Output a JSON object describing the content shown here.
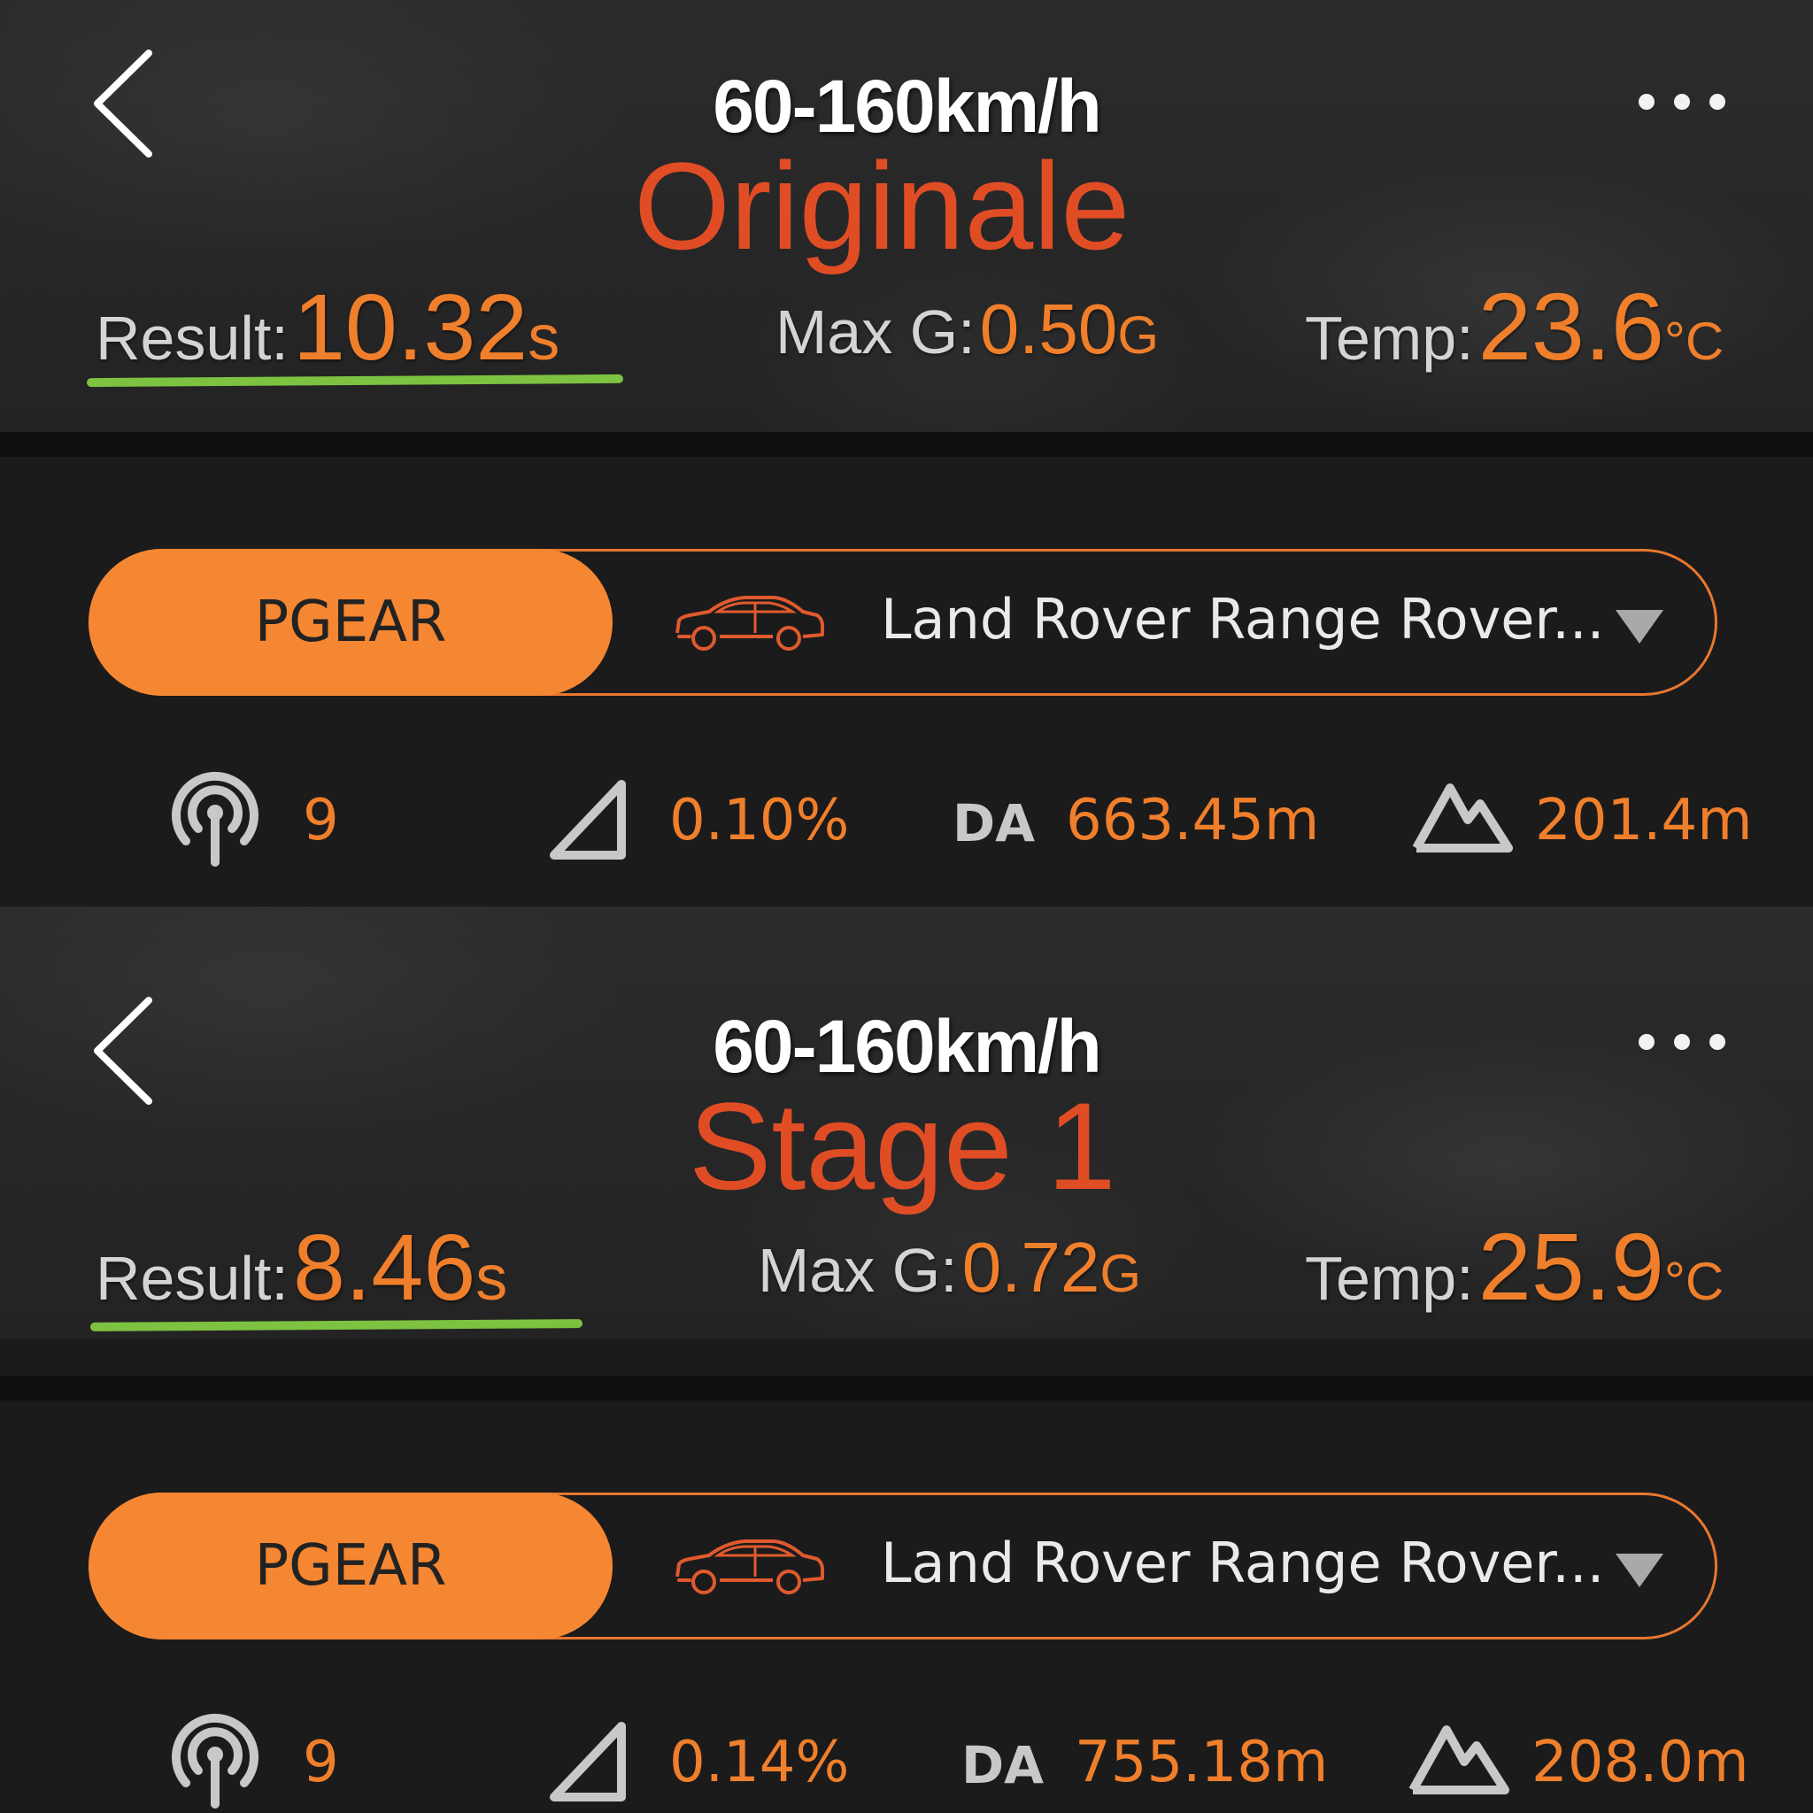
{
  "panels": [
    {
      "title": "60-160km/h",
      "overlay": "Originale",
      "result": {
        "label": "Result:",
        "value": "10.32",
        "unit": "s"
      },
      "max_g": {
        "label": "Max G:",
        "value": "0.50",
        "unit": "G"
      },
      "temp": {
        "label": "Temp:",
        "value": "23.6",
        "unit": "°C"
      },
      "brand": "PGEAR",
      "car": "Land Rover Range Rover...",
      "satellites": "9",
      "slope": "0.10%",
      "da_label": "DA",
      "da_value": "663.45m",
      "altitude": "201.4m"
    },
    {
      "title": "60-160km/h",
      "overlay": "Stage 1",
      "result": {
        "label": "Result:",
        "value": "8.46",
        "unit": "s"
      },
      "max_g": {
        "label": "Max G:",
        "value": "0.72",
        "unit": "G"
      },
      "temp": {
        "label": "Temp:",
        "value": "25.9",
        "unit": "°C"
      },
      "brand": "PGEAR",
      "car": "Land Rover Range Rover...",
      "satellites": "9",
      "slope": "0.14%",
      "da_label": "DA",
      "da_value": "755.18m",
      "altitude": "208.0m"
    }
  ],
  "colors": {
    "accent": "#f58733",
    "value": "#f07f2b",
    "overlay": "#e04d25",
    "underline": "#7dc241",
    "background": "#1b1b1c"
  },
  "icons": [
    "back-chevron-icon",
    "more-dots-icon",
    "car-icon",
    "dropdown-triangle-icon",
    "satellite-signal-icon",
    "slope-triangle-icon",
    "altitude-mountain-icon"
  ]
}
